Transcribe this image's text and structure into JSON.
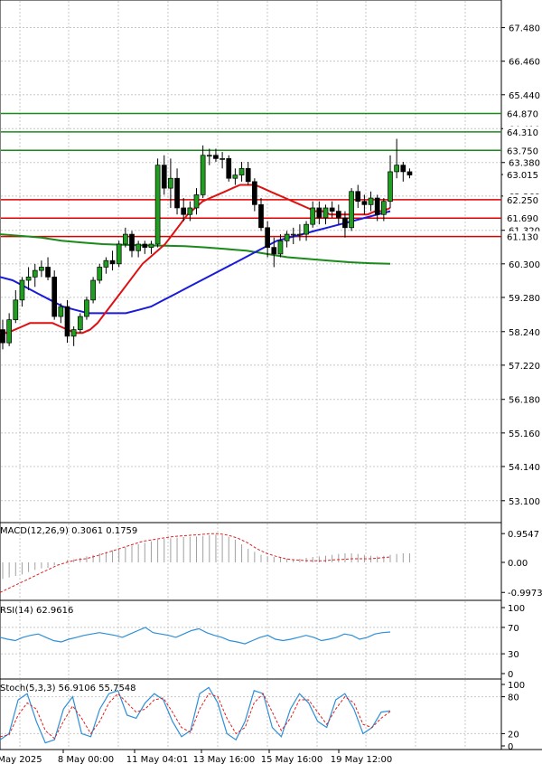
{
  "chart_data": {
    "type": "candlestick",
    "x_ticks": [
      "May 2025",
      "8 May 00:00",
      "11 May 04:01",
      "13 May 16:00",
      "15 May 16:00",
      "19 May 12:00"
    ],
    "price": {
      "ylim": [
        52.6,
        68.1
      ],
      "y_ticks": [
        "67.480",
        "66.460",
        "65.440",
        "64.410",
        "63.380",
        "62.360",
        "61.320",
        "60.300",
        "59.280",
        "58.240",
        "57.220",
        "56.180",
        "55.160",
        "54.140",
        "53.100"
      ],
      "current_price": {
        "value": 63.015,
        "label": "63.015"
      },
      "levels": [
        {
          "value": 64.87,
          "label": "64.870",
          "color": "#1a8a1a"
        },
        {
          "value": 64.31,
          "label": "64.310",
          "color": "#1a8a1a"
        },
        {
          "value": 63.75,
          "label": "63.750",
          "color": "#1a8a1a"
        },
        {
          "value": 62.25,
          "label": "62.250",
          "color": "#dd0000"
        },
        {
          "value": 61.69,
          "label": "61.690",
          "color": "#dd0000"
        },
        {
          "value": 61.13,
          "label": "61.130",
          "color": "#dd0000"
        }
      ],
      "candles": [
        [
          58.3,
          58.6,
          57.7,
          57.9
        ],
        [
          57.9,
          58.8,
          57.8,
          58.6
        ],
        [
          58.6,
          59.5,
          58.5,
          59.2
        ],
        [
          59.2,
          59.9,
          59.0,
          59.8
        ],
        [
          59.8,
          60.2,
          59.5,
          59.9
        ],
        [
          59.9,
          60.3,
          59.6,
          60.1
        ],
        [
          60.1,
          60.4,
          59.9,
          60.2
        ],
        [
          60.2,
          60.5,
          59.8,
          59.9
        ],
        [
          59.9,
          60.1,
          58.6,
          58.7
        ],
        [
          58.7,
          59.1,
          58.5,
          59.0
        ],
        [
          59.0,
          59.2,
          57.9,
          58.1
        ],
        [
          58.1,
          58.4,
          57.8,
          58.3
        ],
        [
          58.3,
          58.8,
          58.2,
          58.7
        ],
        [
          58.7,
          59.3,
          58.6,
          59.2
        ],
        [
          59.2,
          59.9,
          59.1,
          59.8
        ],
        [
          59.8,
          60.3,
          59.7,
          60.2
        ],
        [
          60.2,
          60.5,
          60.0,
          60.4
        ],
        [
          60.4,
          60.7,
          60.1,
          60.3
        ],
        [
          60.3,
          61.0,
          60.2,
          60.9
        ],
        [
          60.9,
          61.4,
          60.8,
          61.2
        ],
        [
          61.2,
          61.3,
          60.5,
          60.7
        ],
        [
          60.7,
          61.0,
          60.5,
          60.9
        ],
        [
          60.9,
          61.0,
          60.6,
          60.8
        ],
        [
          60.8,
          61.0,
          60.6,
          60.9
        ],
        [
          60.9,
          63.5,
          60.8,
          63.3
        ],
        [
          63.3,
          63.6,
          62.4,
          62.6
        ],
        [
          62.6,
          63.5,
          62.0,
          62.9
        ],
        [
          62.9,
          63.2,
          61.8,
          62.0
        ],
        [
          62.0,
          62.3,
          61.6,
          61.8
        ],
        [
          61.8,
          62.2,
          61.6,
          62.0
        ],
        [
          62.0,
          62.6,
          61.8,
          62.4
        ],
        [
          62.4,
          63.9,
          62.3,
          63.6
        ],
        [
          63.6,
          63.8,
          63.3,
          63.6
        ],
        [
          63.6,
          63.8,
          63.4,
          63.5
        ],
        [
          63.5,
          63.7,
          63.2,
          63.5
        ],
        [
          63.5,
          63.6,
          62.8,
          62.9
        ],
        [
          62.9,
          63.2,
          62.7,
          63.0
        ],
        [
          63.0,
          63.4,
          62.8,
          63.2
        ],
        [
          63.2,
          63.4,
          62.7,
          62.8
        ],
        [
          62.8,
          62.9,
          61.9,
          62.1
        ],
        [
          62.1,
          62.3,
          61.3,
          61.4
        ],
        [
          61.4,
          61.6,
          60.5,
          60.8
        ],
        [
          60.8,
          61.1,
          60.2,
          60.6
        ],
        [
          60.6,
          61.2,
          60.5,
          61.0
        ],
        [
          61.0,
          61.3,
          60.8,
          61.2
        ],
        [
          61.2,
          61.4,
          60.9,
          61.2
        ],
        [
          61.2,
          61.5,
          61.0,
          61.2
        ],
        [
          61.2,
          61.6,
          61.0,
          61.5
        ],
        [
          61.5,
          62.2,
          61.4,
          62.0
        ],
        [
          62.0,
          62.2,
          61.5,
          61.7
        ],
        [
          61.7,
          62.1,
          61.5,
          62.0
        ],
        [
          62.0,
          62.2,
          61.7,
          61.9
        ],
        [
          61.9,
          62.1,
          61.5,
          61.7
        ],
        [
          61.7,
          61.9,
          61.1,
          61.4
        ],
        [
          61.4,
          62.6,
          61.3,
          62.5
        ],
        [
          62.5,
          62.7,
          62.0,
          62.2
        ],
        [
          62.2,
          62.4,
          61.8,
          62.1
        ],
        [
          62.1,
          62.5,
          61.9,
          62.3
        ],
        [
          62.3,
          62.4,
          61.6,
          61.8
        ],
        [
          61.8,
          62.3,
          61.6,
          62.2
        ],
        [
          62.2,
          63.6,
          62.0,
          63.1
        ],
        [
          63.1,
          64.1,
          62.9,
          63.3
        ],
        [
          63.3,
          63.4,
          62.8,
          63.1
        ],
        [
          63.1,
          63.2,
          62.9,
          63.0
        ]
      ],
      "sma_red": [
        58.2,
        58.2,
        58.3,
        58.4,
        58.5,
        58.5,
        58.5,
        58.5,
        58.4,
        58.3,
        58.2,
        58.2,
        58.3,
        58.5,
        58.8,
        59.1,
        59.4,
        59.7,
        60.0,
        60.3,
        60.5,
        60.7,
        60.9,
        61.2,
        61.5,
        61.8,
        62.0,
        62.2,
        62.3,
        62.4,
        62.5,
        62.6,
        62.7,
        62.7,
        62.7,
        62.6,
        62.5,
        62.4,
        62.3,
        62.2,
        62.1,
        62.0,
        61.9,
        61.9,
        61.8,
        61.8,
        61.8,
        61.8,
        61.8,
        61.8,
        61.9,
        61.9,
        62.0
      ],
      "sma_blue": [
        59.9,
        59.8,
        59.6,
        59.4,
        59.2,
        59.0,
        58.9,
        58.8,
        58.8,
        58.8,
        58.8,
        58.9,
        59.0,
        59.2,
        59.4,
        59.6,
        59.8,
        60.0,
        60.2,
        60.4,
        60.6,
        60.8,
        61.0,
        61.1,
        61.2,
        61.3,
        61.4,
        61.5,
        61.6,
        61.7,
        61.8,
        61.9
      ],
      "sma_green": [
        61.2,
        61.15,
        61.1,
        61.0,
        60.95,
        60.9,
        60.88,
        60.86,
        60.85,
        60.84,
        60.8,
        60.75,
        60.7,
        60.6,
        60.5,
        60.45,
        60.4,
        60.35,
        60.32,
        60.3
      ]
    },
    "macd": {
      "label": "MACD(12,26,9) 0.3061 0.1759",
      "ylim": [
        -1.08,
        1.08
      ],
      "y_ticks": [
        "0.9547",
        "0.00",
        "-0.9973"
      ],
      "histogram": [
        -0.55,
        -0.5,
        -0.45,
        -0.4,
        -0.32,
        -0.25,
        -0.2,
        -0.18,
        -0.1,
        0.0,
        0.08,
        0.1,
        0.15,
        0.2,
        0.25,
        0.3,
        0.35,
        0.4,
        0.45,
        0.5,
        0.55,
        0.6,
        0.65,
        0.7,
        0.75,
        0.78,
        0.8,
        0.82,
        0.84,
        0.85,
        0.86,
        0.88,
        0.9,
        0.92,
        0.9,
        0.85,
        0.75,
        0.6,
        0.45,
        0.35,
        0.25,
        0.2,
        0.18,
        0.15,
        0.12,
        0.1,
        0.12,
        0.15,
        0.18,
        0.2,
        0.22,
        0.25,
        0.28,
        0.3,
        0.3,
        0.28,
        0.25,
        0.22,
        0.2,
        0.22,
        0.25,
        0.28,
        0.3,
        0.3
      ],
      "signal": [
        -1.0,
        -0.85,
        -0.7,
        -0.55,
        -0.4,
        -0.25,
        -0.1,
        0.0,
        0.08,
        0.12,
        0.2,
        0.3,
        0.4,
        0.5,
        0.6,
        0.7,
        0.75,
        0.8,
        0.85,
        0.88,
        0.9,
        0.92,
        0.95,
        0.95,
        0.9,
        0.8,
        0.65,
        0.45,
        0.3,
        0.2,
        0.12,
        0.08,
        0.06,
        0.05,
        0.05,
        0.08,
        0.1,
        0.12,
        0.12,
        0.12,
        0.15,
        0.18
      ]
    },
    "rsi": {
      "label": "RSI(14) 62.9616",
      "ylim": [
        0,
        100
      ],
      "y_ticks": [
        "100",
        "70",
        "30",
        "0"
      ],
      "values": [
        55,
        52,
        50,
        55,
        58,
        60,
        55,
        50,
        48,
        52,
        55,
        58,
        60,
        62,
        60,
        58,
        55,
        60,
        65,
        70,
        62,
        60,
        58,
        55,
        60,
        65,
        68,
        62,
        58,
        55,
        50,
        48,
        45,
        50,
        55,
        58,
        52,
        50,
        52,
        55,
        58,
        55,
        50,
        52,
        55,
        60,
        58,
        52,
        55,
        60,
        62,
        63
      ]
    },
    "stoch": {
      "label": "Stoch(5,3,3) 56.9106 55.7548",
      "ylim": [
        0,
        100
      ],
      "y_ticks": [
        "100",
        "80",
        "20",
        "0"
      ],
      "k": [
        10,
        20,
        75,
        85,
        40,
        5,
        10,
        60,
        80,
        20,
        15,
        60,
        85,
        90,
        50,
        45,
        70,
        85,
        75,
        40,
        15,
        25,
        85,
        95,
        70,
        20,
        10,
        40,
        90,
        85,
        30,
        15,
        60,
        85,
        70,
        40,
        30,
        75,
        85,
        60,
        20,
        30,
        55,
        57
      ],
      "d": [
        15,
        18,
        50,
        70,
        60,
        25,
        12,
        40,
        65,
        45,
        20,
        40,
        70,
        85,
        70,
        55,
        60,
        75,
        78,
        55,
        30,
        22,
        60,
        85,
        80,
        45,
        20,
        30,
        70,
        85,
        55,
        25,
        45,
        75,
        75,
        55,
        35,
        60,
        80,
        70,
        35,
        30,
        45,
        56
      ]
    }
  }
}
